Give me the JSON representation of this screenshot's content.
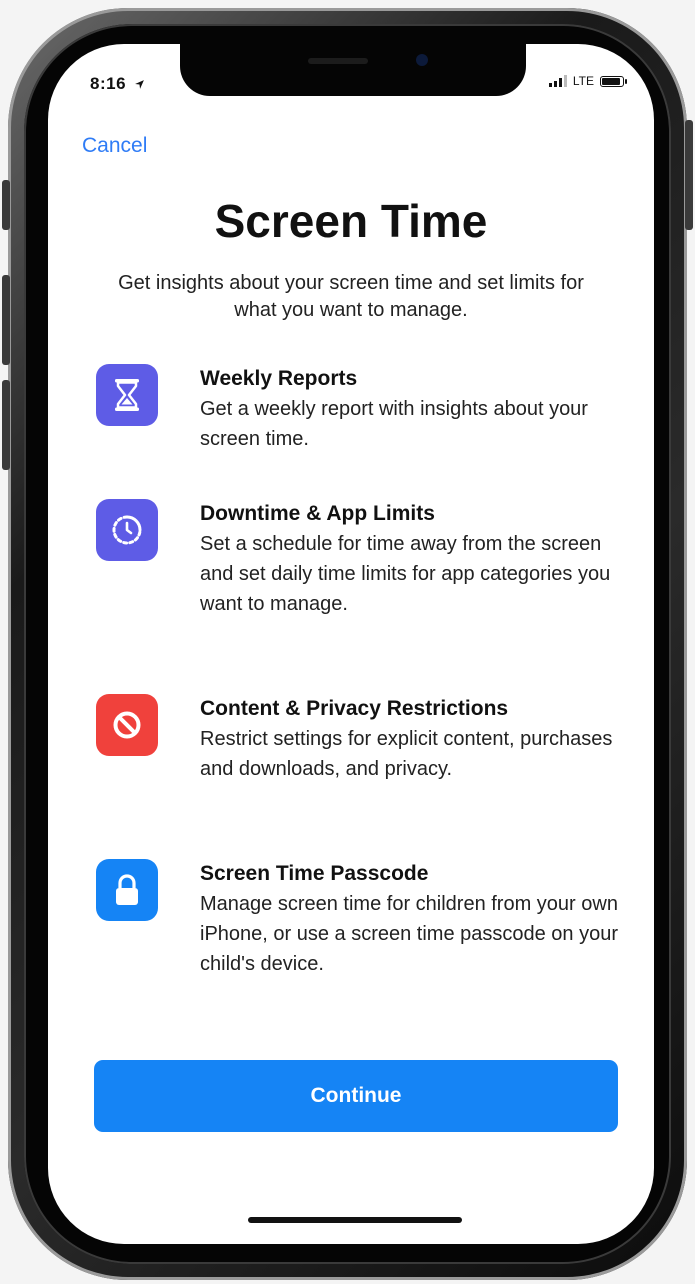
{
  "status_bar": {
    "time": "8:16",
    "network": "LTE"
  },
  "nav": {
    "cancel_label": "Cancel"
  },
  "header": {
    "title": "Screen Time",
    "subtitle": "Get insights about your screen time and set limits for what you want to manage."
  },
  "features": [
    {
      "icon": "hourglass-icon",
      "color": "#5e5ce6",
      "title": "Weekly Reports",
      "description": "Get a weekly report with insights about your screen time."
    },
    {
      "icon": "downtime-icon",
      "color": "#5e5ce6",
      "title": "Downtime & App Limits",
      "description": "Set a schedule for time away from the screen and set daily time limits for app categories you want to manage."
    },
    {
      "icon": "restriction-icon",
      "color": "#f0413c",
      "title": "Content & Privacy Restrictions",
      "description": "Restrict settings for explicit content, purchases and downloads, and privacy."
    },
    {
      "icon": "lock-icon",
      "color": "#1584f5",
      "title": "Screen Time Passcode",
      "description": "Manage screen time for children from your own iPhone, or use a screen time passcode on your child's device."
    }
  ],
  "actions": {
    "continue_label": "Continue"
  },
  "colors": {
    "accent": "#1584f5",
    "link": "#2f7cf6",
    "purple": "#5e5ce6",
    "red": "#f0413c"
  }
}
